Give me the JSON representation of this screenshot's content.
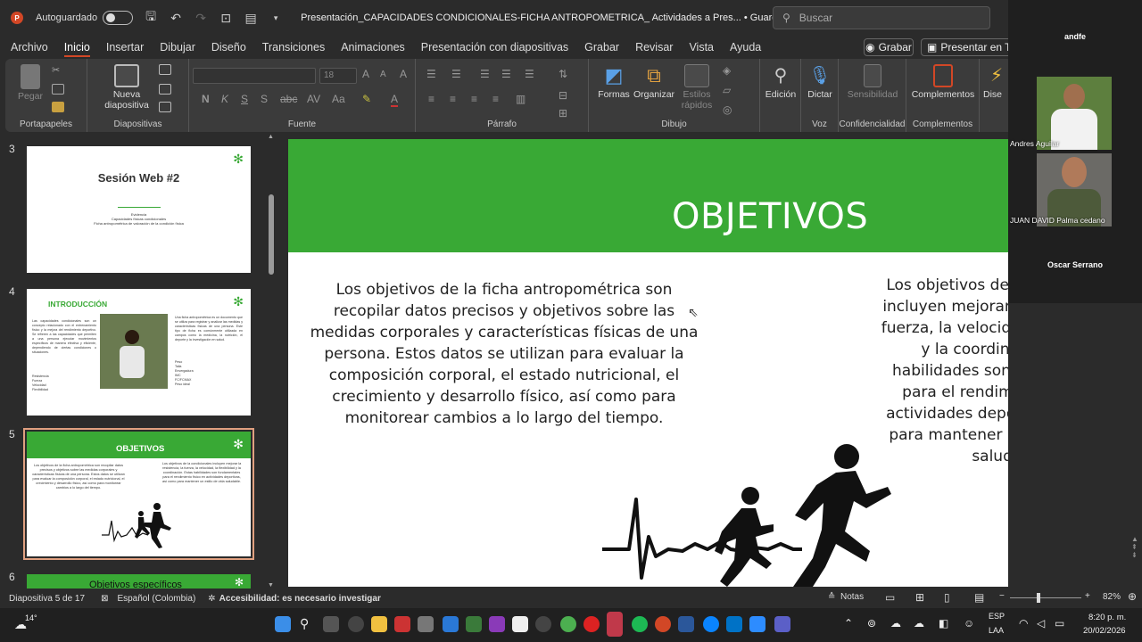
{
  "titlebar": {
    "autosave_label": "Autoguardado",
    "doc_title": "Presentación_CAPACIDADES CONDICIONALES-FICHA ANTROPOMETRICA_ Actividades a Pres...  •  Guardado en Este PC",
    "search_placeholder": "Buscar"
  },
  "menu": {
    "items": [
      "Archivo",
      "Inicio",
      "Insertar",
      "Dibujar",
      "Diseño",
      "Transiciones",
      "Animaciones",
      "Presentación con diapositivas",
      "Grabar",
      "Revisar",
      "Vista",
      "Ayuda"
    ],
    "active": "Inicio",
    "grabar_button": "Grabar",
    "present_button": "Presentar en Tea"
  },
  "ribbon": {
    "groups": {
      "clipboard": "Portapapeles",
      "slides": "Diapositivas",
      "font": "Fuente",
      "paragraph": "Párrafo",
      "drawing": "Dibujo",
      "voice": "Voz",
      "sensitivity": "Confidencialidad",
      "addins": "Complementos"
    },
    "buttons": {
      "paste": "Pegar",
      "new_slide_1": "Nueva",
      "new_slide_2": "diapositiva",
      "font_size": "18",
      "shapes": "Formas",
      "arrange": "Organizar",
      "quick_styles_1": "Estilos",
      "quick_styles_2": "rápidos",
      "editing": "Edición",
      "dictate": "Dictar",
      "sensitivity": "Sensibilidad",
      "addins": "Complementos",
      "designer": "Dise"
    }
  },
  "slides_panel": {
    "slide_numbers": [
      "3",
      "4",
      "5",
      "6"
    ],
    "slide3_title": "Sesión Web #2",
    "slide3_line1": "Evidencia",
    "slide3_line2": "Capacidades físicas condicionales",
    "slide3_line3": "Ficha antropométrica de valoración de la condición física",
    "slide4_title": "INTRODUCCIÓN",
    "slide4_text_left": "Las capacidades condicionales son un concepto relacionado con el entrenamiento físico y la mejora del rendimiento deportivo. Se refieren a las capacidades que permiten a una persona ejecutar movimientos específicos de manera efectiva y eficiente, dependiendo de ciertas condiciones o situaciones.",
    "slide4_list_left": "Resistencia\nFuerza\nVelocidad\nFlexibilidad",
    "slide4_text_right": "Una ficha antropométrica es un documento que se utiliza para registrar y analizar las medidas y características físicas de una persona. Este tipo de ficha es comúnmente utilizada en campos como la medicina, la nutrición, el deporte y la investigación en salud.",
    "slide4_list_right": "Peso\nTalla\nEnvergadura\nIMC\nFC/FCMAX\nPeso ideal",
    "slide5_title": "OBJETIVOS",
    "slide6_title": "Objetivos específicos"
  },
  "slide": {
    "title": "OBJETIVOS",
    "body_left": "Los objetivos de la ficha antropométrica son recopilar datos precisos y objetivos sobre las medidas corporales y características físicas de una persona. Estos datos se utilizan para evaluar la composición corporal, el estado nutricional, el crecimiento y desarrollo físico, así como para monitorear cambios a lo largo del tiempo.",
    "body_right": "Los objetivos de la                condicionales incluyen mejorar la resistencia, la fuerza, la velocidad, la flexibilidad y la coordinación. Estas habilidades son fundamentales para el rendimiento físico en actividades deportivas, así como para mantener un estilo de vida saludable.",
    "band_color": "#39a935"
  },
  "participants": [
    {
      "name": "andfe"
    },
    {
      "name": "Andres  Aguilar"
    },
    {
      "name": "JUAN DAVID Palma cedano"
    },
    {
      "name": "Oscar Serrano"
    }
  ],
  "statusbar": {
    "slide_info": "Diapositiva 5 de 17",
    "language": "Español (Colombia)",
    "accessibility": "Accesibilidad: es necesario investigar",
    "notes": "Notas",
    "zoom": "82%"
  },
  "taskbar": {
    "temperature": "14°",
    "lang_1": "ESP",
    "lang_2": "LAA",
    "time": "8:20 p. m.",
    "date": "20/02/2026"
  }
}
